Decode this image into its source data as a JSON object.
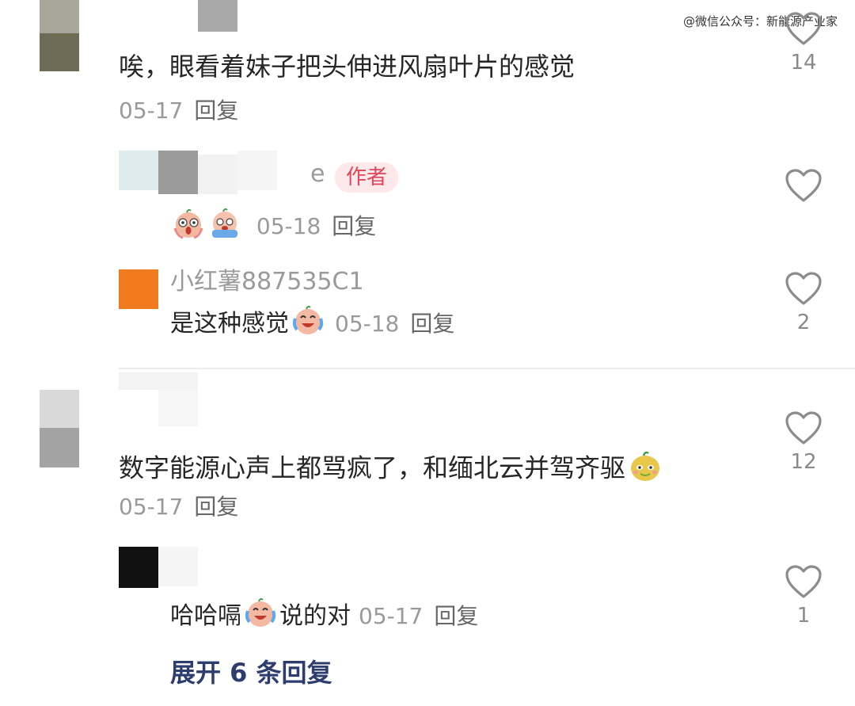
{
  "watermark": "@微信公众号：新能源产业家",
  "comments": [
    {
      "text": "唉，眼看着妹子把头伸进风扇叶片的感觉",
      "date": "05-17",
      "reply_label": "回复",
      "likes": "14"
    },
    {
      "author_badge": "作者",
      "partial_name": "e",
      "date": "05-18",
      "reply_label": "回复",
      "emojis": [
        "scream-emoji",
        "cry-emoji"
      ]
    },
    {
      "username": "小红薯887535C1",
      "text": "是这种感觉",
      "date": "05-18",
      "reply_label": "回复",
      "likes": "2",
      "emojis": [
        "laugh-cry-emoji"
      ]
    },
    {
      "text": "数字能源心声上都骂疯了，和缅北云并驾齐驱",
      "date": "05-17",
      "reply_label": "回复",
      "likes": "12",
      "emojis": [
        "smirk-emoji"
      ]
    },
    {
      "text_before": "哈哈嗝",
      "text_after": "说的对",
      "date": "05-17",
      "reply_label": "回复",
      "likes": "1",
      "emojis": [
        "laugh-cry-emoji"
      ]
    }
  ],
  "expand_replies": "展开 6 条回复"
}
